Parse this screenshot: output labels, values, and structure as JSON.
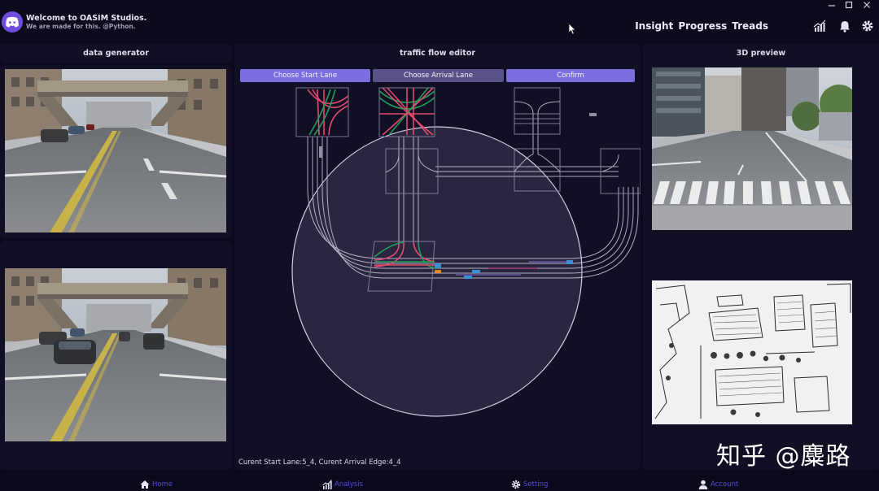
{
  "header": {
    "title": "Welcome to OASIM Studios.",
    "subtitle": "We are made for this. @Python.",
    "nav": [
      "Insight",
      "Progress",
      "Treads"
    ],
    "icons": [
      "chart-icon",
      "bell-icon",
      "gear-icon"
    ],
    "window_controls": [
      "minimize-icon",
      "maximize-icon",
      "close-icon"
    ]
  },
  "left_panel": {
    "title": "data generator"
  },
  "center_panel": {
    "title": "traffic flow editor",
    "buttons": [
      "Choose Start Lane",
      "Choose Arrival Lane",
      "Confirm"
    ],
    "status": "Curent Start Lane:5_4, Curent Arrival Edge:4_4"
  },
  "right_panel": {
    "title": "3D preview"
  },
  "watermark": "知乎 @麋路",
  "bottom_nav": [
    {
      "label": "Home",
      "icon": "home-icon"
    },
    {
      "label": "Analysis",
      "icon": "analysis-icon"
    },
    {
      "label": "Setting",
      "icon": "gear-icon"
    },
    {
      "label": "Account",
      "icon": "user-icon"
    }
  ],
  "colors": {
    "background": "#0b0a1c",
    "panel": "#100f24",
    "accent": "#7a6ee0",
    "nav_text": "#5b49d6"
  }
}
